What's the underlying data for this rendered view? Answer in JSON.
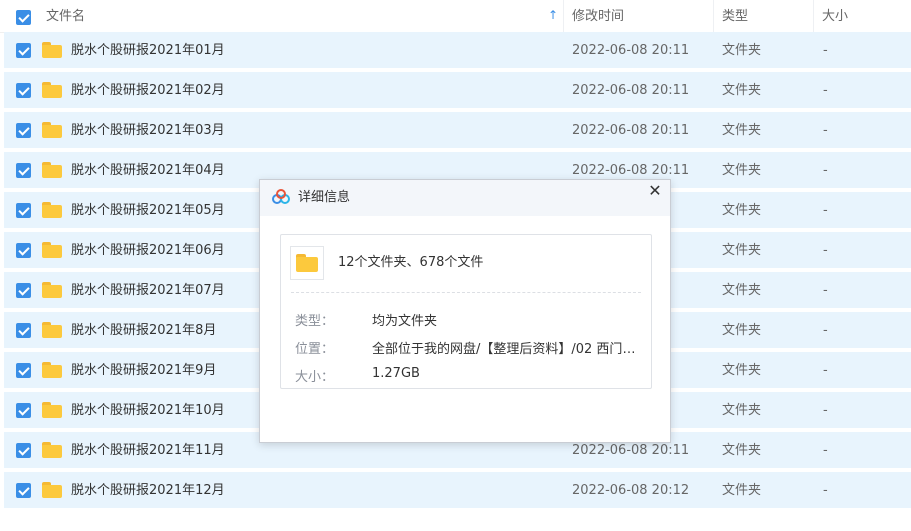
{
  "header": {
    "name_label": "文件名",
    "time_label": "修改时间",
    "type_label": "类型",
    "size_label": "大小",
    "sort_arrow": "↑"
  },
  "files": [
    {
      "name": "脱水个股研报2021年01月",
      "time": "2022-06-08 20:11",
      "type": "文件夹",
      "size": "-"
    },
    {
      "name": "脱水个股研报2021年02月",
      "time": "2022-06-08 20:11",
      "type": "文件夹",
      "size": "-"
    },
    {
      "name": "脱水个股研报2021年03月",
      "time": "2022-06-08 20:11",
      "type": "文件夹",
      "size": "-"
    },
    {
      "name": "脱水个股研报2021年04月",
      "time": "2022-06-08 20:11",
      "type": "文件夹",
      "size": "-"
    },
    {
      "name": "脱水个股研报2021年05月",
      "time": "",
      "type": "文件夹",
      "size": "-"
    },
    {
      "name": "脱水个股研报2021年06月",
      "time": "",
      "type": "文件夹",
      "size": "-"
    },
    {
      "name": "脱水个股研报2021年07月",
      "time": "",
      "type": "文件夹",
      "size": "-"
    },
    {
      "name": "脱水个股研报2021年8月",
      "time": "",
      "type": "文件夹",
      "size": "-"
    },
    {
      "name": "脱水个股研报2021年9月",
      "time": "",
      "type": "文件夹",
      "size": "-"
    },
    {
      "name": "脱水个股研报2021年10月",
      "time": "",
      "type": "文件夹",
      "size": "-"
    },
    {
      "name": "脱水个股研报2021年11月",
      "time": "2022-06-08 20:11",
      "type": "文件夹",
      "size": "-"
    },
    {
      "name": "脱水个股研报2021年12月",
      "time": "2022-06-08 20:12",
      "type": "文件夹",
      "size": "-"
    }
  ],
  "dialog": {
    "title": "详细信息",
    "close": "✕",
    "summary": "12个文件夹、678个文件",
    "type_key": "类型：",
    "type_value": "均为文件夹",
    "location_key": "位置：",
    "location_value": "全部位于我的网盘/【整理后资料】/02 西门学院/...",
    "size_key": "大小：",
    "size_value": "1.27GB"
  },
  "colors": {
    "accent": "#3a8ee6",
    "row_selected": "#e8f4fd",
    "folder": "#fcc93d"
  },
  "icons": [
    "check-icon",
    "folder-icon",
    "sort-up-icon",
    "baidu-cloud-logo-icon",
    "close-icon"
  ]
}
